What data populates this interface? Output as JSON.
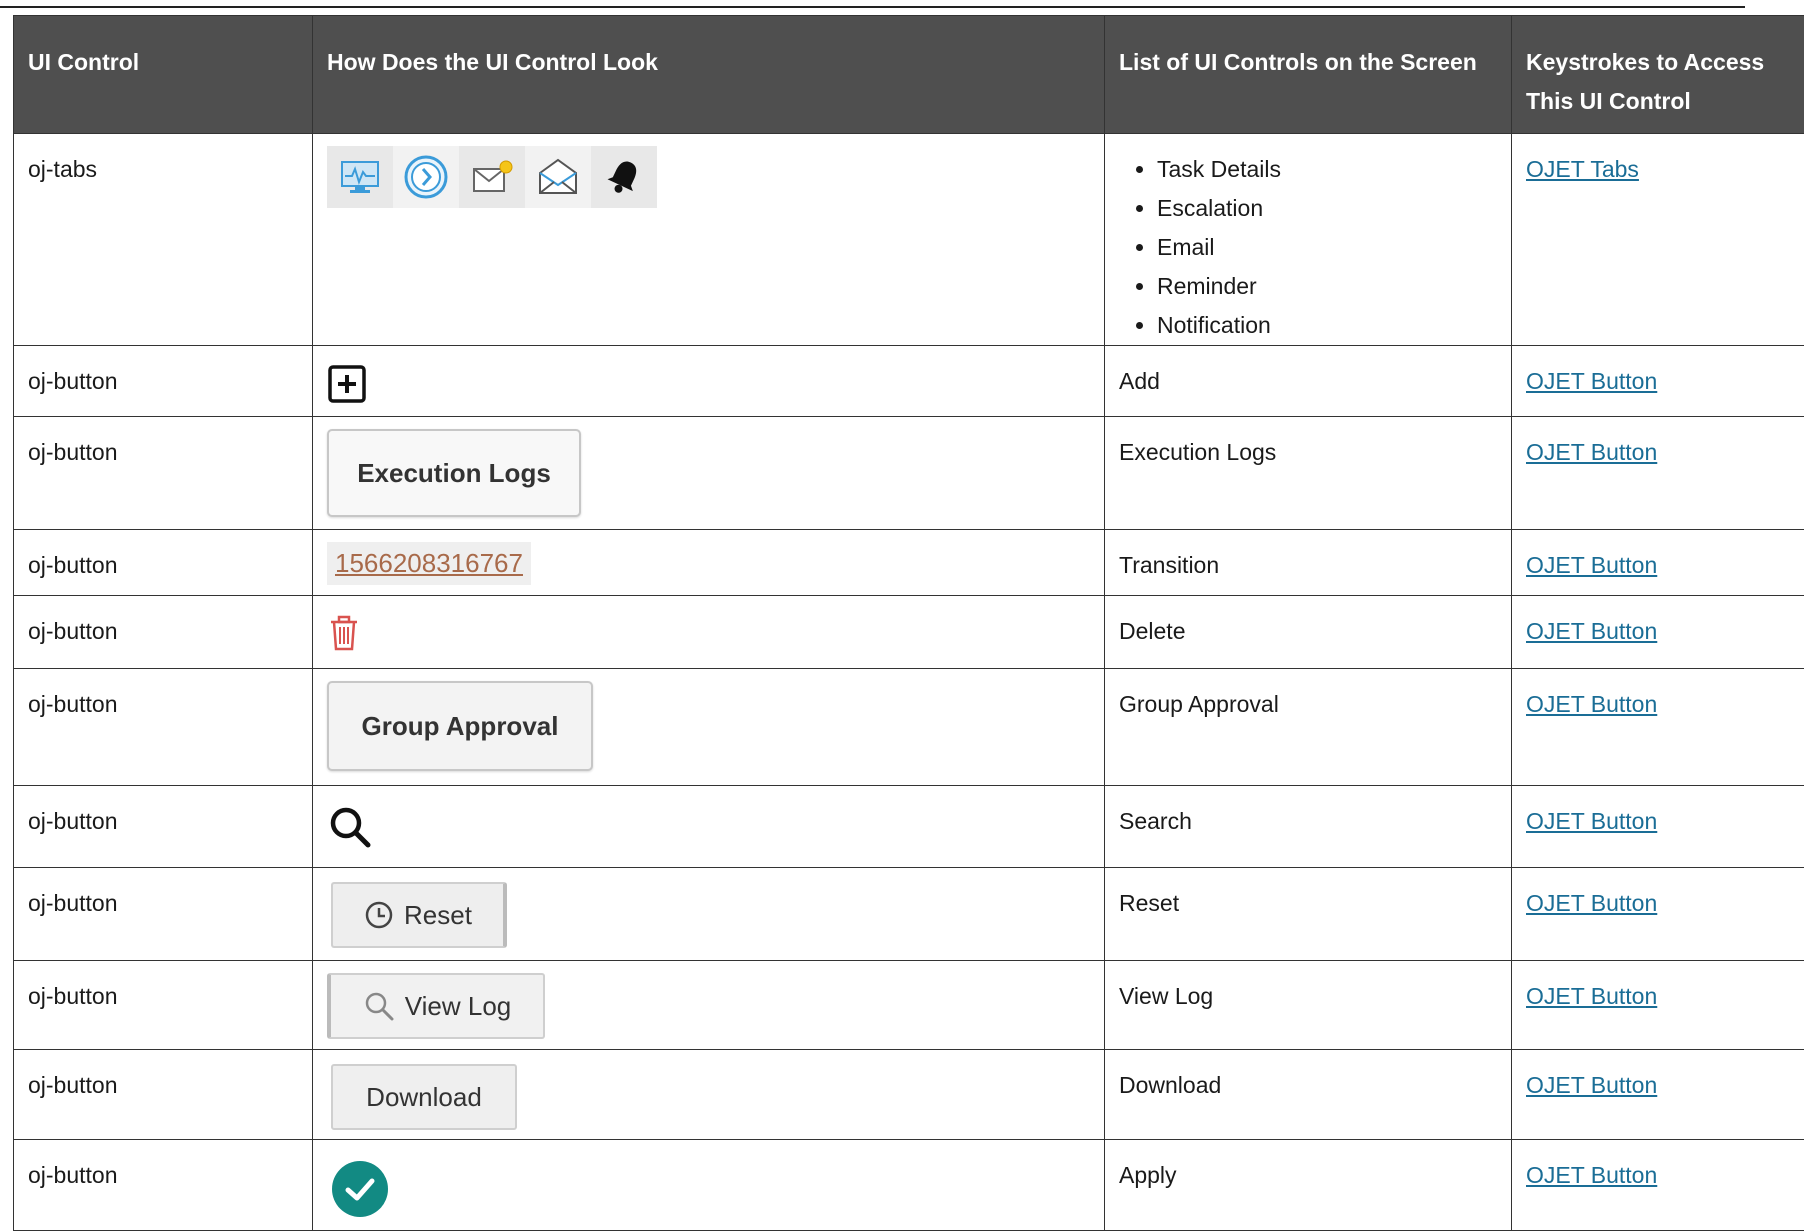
{
  "table": {
    "headers": {
      "col1": "UI Control",
      "col2": "How Does the UI Control Look",
      "col3": "List of UI Controls on the Screen",
      "col4": "Keystrokes to Access This UI Control"
    },
    "rows": [
      {
        "control": "oj-tabs",
        "items": [
          "Task Details",
          "Escalation",
          "Email",
          "Reminder",
          "Notification"
        ],
        "link": "OJET Tabs",
        "icons": [
          "monitor-icon",
          "clock-arrow-icon",
          "email-new-icon",
          "open-envelope-icon",
          "bell-icon"
        ]
      },
      {
        "control": "oj-button",
        "screen": "Add",
        "link": "OJET Button",
        "icon": "plus-square-icon"
      },
      {
        "control": "oj-button",
        "screen": "Execution Logs",
        "link": "OJET Button",
        "look_label": "Execution Logs"
      },
      {
        "control": "oj-button",
        "screen": "Transition",
        "link": "OJET Button",
        "look_label": "1566208316767"
      },
      {
        "control": "oj-button",
        "screen": "Delete",
        "link": "OJET Button",
        "icon": "trash-icon"
      },
      {
        "control": "oj-button",
        "screen": "Group Approval",
        "link": "OJET Button",
        "look_label": "Group Approval"
      },
      {
        "control": "oj-button",
        "screen": "Search",
        "link": "OJET Button",
        "icon": "search-icon"
      },
      {
        "control": "oj-button",
        "screen": "Reset",
        "link": "OJET Button",
        "look_label": "Reset",
        "icon": "clock-icon"
      },
      {
        "control": "oj-button",
        "screen": "View Log",
        "link": "OJET Button",
        "look_label": "View Log",
        "icon": "magnifier-icon"
      },
      {
        "control": "oj-button",
        "screen": "Download",
        "link": "OJET Button",
        "look_label": "Download"
      },
      {
        "control": "oj-button",
        "screen": "Apply",
        "link": "OJET Button",
        "icon": "check-circle-icon"
      }
    ]
  },
  "colors": {
    "header_bg": "#4f4f4f",
    "link": "#1a6d96",
    "delete_red": "#d9534f",
    "apply_teal": "#128a83"
  }
}
